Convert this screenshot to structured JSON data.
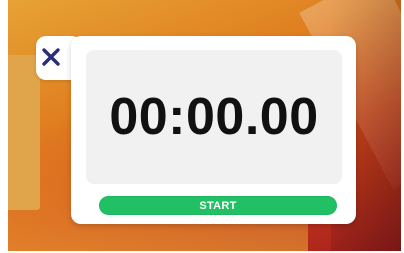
{
  "stopwatch": {
    "time_display": "00:00.00",
    "start_label": "START",
    "close_icon": "close-icon",
    "colors": {
      "accent_green": "#22c064",
      "close_icon": "#2a2d7a",
      "display_bg": "#f1f1f1",
      "time_text": "#111111"
    }
  }
}
